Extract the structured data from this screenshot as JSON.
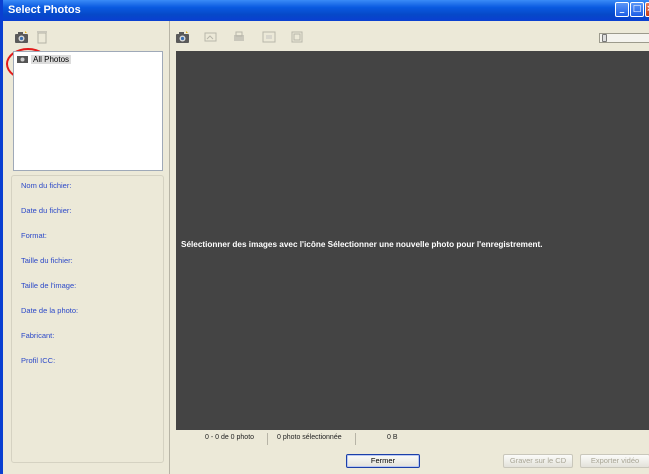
{
  "window": {
    "title": "Select Photos"
  },
  "titlebar_buttons": {
    "minimize": "_",
    "maximize": "□",
    "close": "×"
  },
  "left_toolbar": {
    "items": [
      {
        "name": "select-photo-icon",
        "enabled": true
      },
      {
        "name": "delete-icon",
        "enabled": false
      }
    ]
  },
  "tree": {
    "items": [
      {
        "label": "All Photos"
      }
    ]
  },
  "info_labels": [
    "Nom du fichier:",
    "Date du fichier:",
    "Format:",
    "Taille du fichier:",
    "Taille de l'image:",
    "Date de la photo:",
    "Fabricant:",
    "Profil ICC:"
  ],
  "right_toolbar": {
    "items": [
      {
        "name": "select-photo-icon",
        "enabled": true
      },
      {
        "name": "rotate-icon",
        "enabled": false
      },
      {
        "name": "print-icon",
        "enabled": false
      },
      {
        "name": "fit-icon",
        "enabled": false
      },
      {
        "name": "fullscreen-icon",
        "enabled": false
      }
    ]
  },
  "viewer": {
    "message": "Sélectionner des images avec l'icône Sélectionner une nouvelle photo pour l'enregistrement."
  },
  "status": {
    "count": "0 - 0 de 0 photo",
    "selected": "0 photo sélectionnée",
    "size": "0 B"
  },
  "buttons": {
    "close": "Fermer",
    "burn_cd": "Graver sur le CD",
    "export_video": "Exporter vidéo"
  },
  "colors": {
    "titlebar": "#0a5ae0",
    "viewer_bg": "#444444",
    "label_blue": "#2b48c8",
    "highlight_circle": "#e21a1a"
  }
}
